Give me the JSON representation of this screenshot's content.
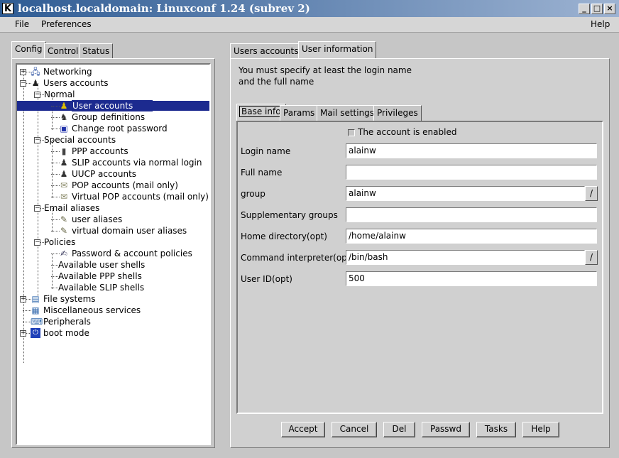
{
  "window": {
    "title": "localhost.localdomain: Linuxconf 1.24 (subrev 2)",
    "app_icon": "k-icon",
    "controls": [
      "_",
      "□",
      "×"
    ]
  },
  "menubar": {
    "file": "File",
    "preferences": "Preferences",
    "help": "Help"
  },
  "left_tabs": [
    "Config",
    "Control",
    "Status"
  ],
  "tree": [
    {
      "label": "Networking",
      "expander": "+",
      "icon": "network-icon"
    },
    {
      "label": "Users accounts",
      "expander": "−",
      "icon": "users-icon"
    },
    {
      "label": "Normal",
      "expander": "−",
      "icon": ""
    },
    {
      "label": "User accounts",
      "expander": "",
      "icon": "user-icon",
      "selected": true
    },
    {
      "label": "Group definitions",
      "expander": "",
      "icon": "group-icon"
    },
    {
      "label": "Change root password",
      "expander": "",
      "icon": "root-icon"
    },
    {
      "label": "Special accounts",
      "expander": "−",
      "icon": ""
    },
    {
      "label": "PPP accounts",
      "expander": "",
      "icon": "ppp-icon"
    },
    {
      "label": "SLIP accounts via normal login",
      "expander": "",
      "icon": "slip-icon"
    },
    {
      "label": "UUCP accounts",
      "expander": "",
      "icon": "uucp-icon"
    },
    {
      "label": "POP accounts (mail only)",
      "expander": "",
      "icon": "pop-icon"
    },
    {
      "label": "Virtual POP accounts (mail only)",
      "expander": "",
      "icon": "virtual-pop-icon"
    },
    {
      "label": "Email aliases",
      "expander": "−",
      "icon": ""
    },
    {
      "label": "user aliases",
      "expander": "",
      "icon": "alias-icon"
    },
    {
      "label": "virtual domain user aliases",
      "expander": "",
      "icon": "alias-icon"
    },
    {
      "label": "Policies",
      "expander": "−",
      "icon": ""
    },
    {
      "label": "Password & account policies",
      "expander": "",
      "icon": "policy-icon"
    },
    {
      "label": "Available user shells",
      "expander": "",
      "icon": ""
    },
    {
      "label": "Available PPP shells",
      "expander": "",
      "icon": ""
    },
    {
      "label": "Available SLIP shells",
      "expander": "",
      "icon": ""
    },
    {
      "label": "File systems",
      "expander": "+",
      "icon": "filesystem-icon"
    },
    {
      "label": "Miscellaneous services",
      "expander": "",
      "icon": "misc-icon"
    },
    {
      "label": "Peripherals",
      "expander": "",
      "icon": "peripherals-icon"
    },
    {
      "label": "boot mode",
      "expander": "+",
      "icon": "boot-icon"
    }
  ],
  "right_tabs": [
    "Users accounts",
    "User information"
  ],
  "instructions": [
    "You must specify at least the login name",
    "and the full name"
  ],
  "inner_tabs": [
    "Base info",
    "Params",
    "Mail settings",
    "Privileges"
  ],
  "form": {
    "enabled_label": "The account is enabled",
    "fields": [
      {
        "label": "Login name",
        "value": "alainw"
      },
      {
        "label": "Full name",
        "value": ""
      },
      {
        "label": "group",
        "value": "alainw"
      },
      {
        "label": "Supplementary groups",
        "value": ""
      },
      {
        "label": "Home directory(opt)",
        "value": "/home/alainw"
      },
      {
        "label": "Command interpreter(opt)",
        "value": "/bin/bash"
      },
      {
        "label": "User ID(opt)",
        "value": "500"
      }
    ],
    "dropdown_glyph": "/"
  },
  "buttons": [
    "Accept",
    "Cancel",
    "Del",
    "Passwd",
    "Tasks",
    "Help"
  ]
}
